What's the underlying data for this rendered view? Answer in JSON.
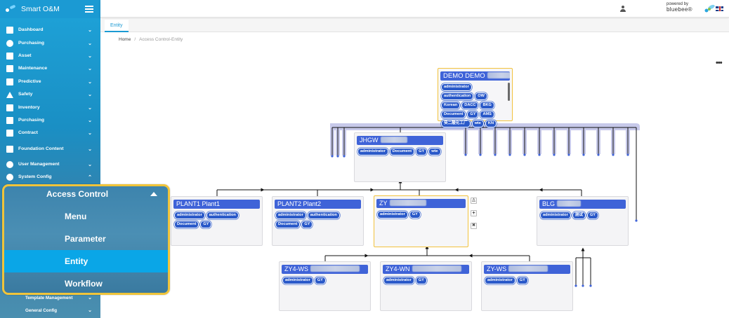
{
  "app": {
    "title": "Smart O&M"
  },
  "sidebar": {
    "items": [
      {
        "label": "Dashboard",
        "icon": "dashboard-icon"
      },
      {
        "label": "Purchasing",
        "icon": "phone-icon"
      },
      {
        "label": "Asset",
        "icon": "clipboard-icon"
      },
      {
        "label": "Maintenance",
        "icon": "info-icon"
      },
      {
        "label": "Predictive",
        "icon": "person-icon"
      },
      {
        "label": "Safety",
        "icon": "warning-icon"
      },
      {
        "label": "Inventory",
        "icon": "list-icon"
      },
      {
        "label": "Purchasing",
        "icon": "person-icon"
      },
      {
        "label": "Contract",
        "icon": "document-icon"
      },
      {
        "label": "Foundation Content",
        "icon": "grid-icon"
      },
      {
        "label": "User Management",
        "icon": "user-group-icon"
      },
      {
        "label": "System Config",
        "icon": "gear-icon"
      }
    ],
    "sub_items": [
      "Template Management",
      "General Config"
    ]
  },
  "popup": {
    "title": "Access Control",
    "items": [
      {
        "label": "Menu"
      },
      {
        "label": "Parameter"
      },
      {
        "label": "Entity"
      },
      {
        "label": "Workflow"
      }
    ]
  },
  "topbar": {
    "powered_by": "powered by",
    "brand": "bluebee®"
  },
  "tabs": [
    {
      "label": "Entity"
    }
  ],
  "breadcrumb": {
    "home": "Home",
    "separator": "/",
    "current": "Access Control-Entity"
  },
  "more_menu": "•••",
  "nodes": [
    {
      "id": "demo",
      "title": "DEMO DEMO",
      "tags": [
        "administrator",
        "authentication",
        "OW",
        "Korean",
        "DACC",
        "BKG",
        "Document",
        "GY",
        "AMS",
        "癸二酸化工厂",
        "wte",
        "KN"
      ]
    },
    {
      "id": "jhgw",
      "title": "JHGW",
      "tags": [
        "administrator",
        "Document",
        "GY",
        "wte"
      ]
    },
    {
      "id": "plant1",
      "title": "PLANT1 Plant1",
      "tags": [
        "administrator",
        "authentication",
        "Document",
        "GY"
      ]
    },
    {
      "id": "plant2",
      "title": "PLANT2 Plant2",
      "tags": [
        "administrator",
        "authentication",
        "Document",
        "GY"
      ]
    },
    {
      "id": "zy",
      "title": "ZY",
      "tags": [
        "administrator",
        "GY"
      ]
    },
    {
      "id": "blg",
      "title": "BLG",
      "tags": [
        "administrator",
        "测试",
        "GY"
      ]
    },
    {
      "id": "zy4ws",
      "title": "ZY4-WS",
      "tags": [
        "administrator",
        "GY"
      ]
    },
    {
      "id": "zy4wn",
      "title": "ZY4-WN",
      "tags": [
        "administrator",
        "GY"
      ]
    },
    {
      "id": "zyws",
      "title": "ZY-WS",
      "tags": [
        "administrator",
        "GY"
      ]
    }
  ],
  "node_controls": {
    "user": "♙",
    "add": "+",
    "remove": "✖"
  }
}
